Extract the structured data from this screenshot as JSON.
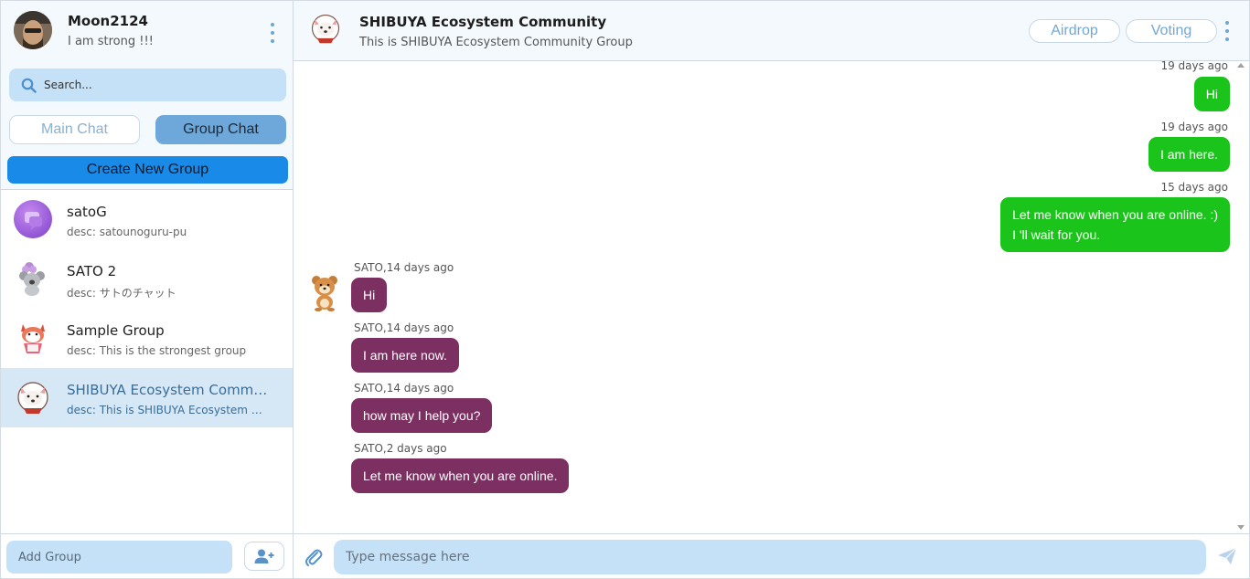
{
  "profile": {
    "name": "Moon2124",
    "status": "I am strong !!!",
    "menu_icon": "kebab-menu-icon"
  },
  "search": {
    "placeholder": "Search...",
    "icon": "search-icon"
  },
  "tabs": {
    "main_chat": "Main Chat",
    "group_chat": "Group Chat",
    "active": "Group Chat"
  },
  "create_group_label": "Create New Group",
  "groups": [
    {
      "name": "satoG",
      "desc": "desc: satounoguru-pu",
      "avatar": "purple-chat-avatar"
    },
    {
      "name": "SATO 2",
      "desc": "desc: サトのチャット",
      "avatar": "koala-avatar"
    },
    {
      "name": "Sample Group",
      "desc": "desc: This is the strongest group",
      "avatar": "shiba-red-avatar"
    },
    {
      "name": "SHIBUYA Ecosystem Community Group",
      "desc": "desc: This is SHIBUYA Ecosystem Community Group",
      "avatar": "shiba-white-avatar",
      "active": true
    }
  ],
  "add_group": {
    "placeholder": "Add Group",
    "button_icon": "add-user-icon"
  },
  "chat": {
    "title": "SHIBUYA Ecosystem Community",
    "subtitle": "This is SHIBUYA Ecosystem Community Group",
    "airdrop_label": "Airdrop",
    "voting_label": "Voting",
    "outgoing": [
      {
        "time": "19 days ago",
        "lines": [
          "Hi"
        ]
      },
      {
        "time": "19 days ago",
        "lines": [
          "I am here."
        ]
      },
      {
        "time": "15 days ago",
        "lines": [
          "Let me know when you are online. :)",
          "I 'll wait for you."
        ]
      }
    ],
    "incoming": [
      {
        "meta": "SATO,14 days ago",
        "text": "Hi"
      },
      {
        "meta": "SATO,14 days ago",
        "text": "I am here now."
      },
      {
        "meta": "SATO,14 days ago",
        "text": "how may I help you?"
      },
      {
        "meta": "SATO,2 days ago",
        "text": "Let me know when you are online."
      }
    ],
    "composer_placeholder": "Type message here"
  },
  "colors": {
    "outgoing_bubble": "#1bc41b",
    "incoming_bubble": "#7c2f61",
    "accent": "#1a8ae8",
    "input_bg": "#c5e1f8"
  }
}
